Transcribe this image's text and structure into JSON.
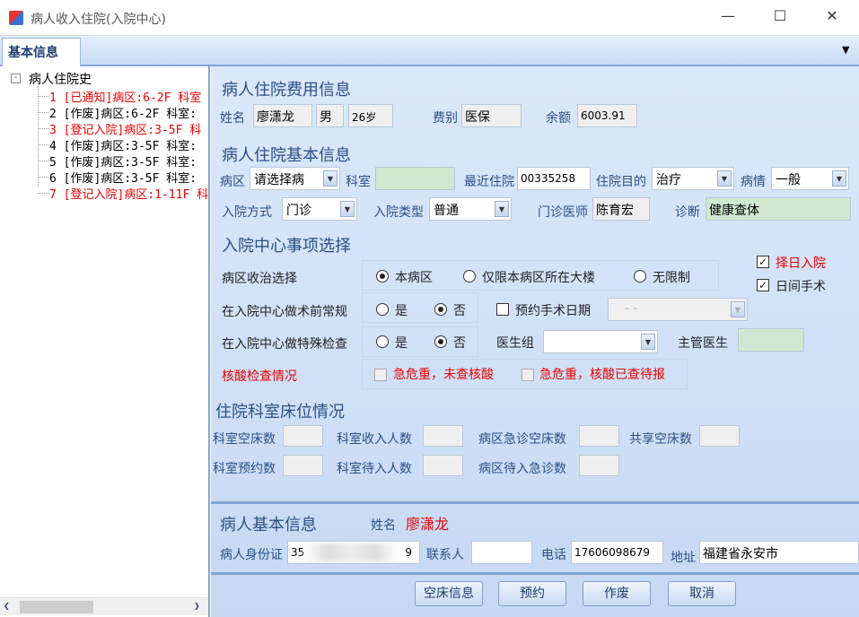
{
  "window": {
    "title": "病人收入住院(入院中心)",
    "min": "—",
    "max": "☐",
    "close": "✕"
  },
  "tab": {
    "label": "基本信息",
    "dropdown": "▼"
  },
  "tree": {
    "root": "病人住院史",
    "items": [
      {
        "text": "1 [已通知]病区:6-2F 科室",
        "color": "red"
      },
      {
        "text": "2 [作废]病区:6-2F 科室:",
        "color": "black"
      },
      {
        "text": "3 [登记入院]病区:3-5F 科",
        "color": "red"
      },
      {
        "text": "4 [作废]病区:3-5F 科室:",
        "color": "black"
      },
      {
        "text": "5 [作废]病区:3-5F 科室:",
        "color": "black"
      },
      {
        "text": "6 [作废]病区:3-5F 科室:",
        "color": "black"
      },
      {
        "text": "7 [登记入院]病区:1-11F 科",
        "color": "red"
      }
    ]
  },
  "fee": {
    "title": "病人住院费用信息",
    "name_label": "姓名",
    "name": "廖潇龙",
    "sex": "男",
    "age": "26岁",
    "type_label": "费别",
    "type": "医保",
    "balance_label": "余额",
    "balance": "6003.91"
  },
  "basic": {
    "title": "病人住院基本信息",
    "ward_label": "病区",
    "ward": "请选择病",
    "dept_label": "科室",
    "dept": "",
    "recent_label": "最近住院",
    "recent": "00335258",
    "purpose_label": "住院目的",
    "purpose": "治疗",
    "condition_label": "病情",
    "condition": "一般",
    "method_label": "入院方式",
    "method": "门诊",
    "admtype_label": "入院类型",
    "admtype": "普通",
    "doctor_label": "门诊医师",
    "doctor": "陈育宏",
    "diag_label": "诊断",
    "diag": "健康查体"
  },
  "center": {
    "title": "入院中心事项选择",
    "ward_choice_label": "病区收治选择",
    "opt_this": "本病区",
    "opt_building": "仅限本病区所在大楼",
    "opt_none": "无限制",
    "pre_op_label": "在入院中心做术前常规",
    "yes": "是",
    "no": "否",
    "book_op_label": "预约手术日期",
    "book_op_value": "-   -",
    "special_label": "在入院中心做特殊检查",
    "doctor_group_label": "医生组",
    "doctor_group": "",
    "attending_label": "主管医生",
    "attending": "",
    "select_day_label": "择日入院",
    "day_surgery_label": "日间手术",
    "nucleic_label": "核酸检查情况",
    "nucleic_opt1": "急危重，未查核酸",
    "nucleic_opt2": "急危重，核酸已查待报"
  },
  "beds": {
    "title": "住院科室床位情况",
    "empty_label": "科室空床数",
    "income_label": "科室收入人数",
    "ward_emergency_empty_label": "病区急诊空床数",
    "shared_empty_label": "共享空床数",
    "booked_label": "科室预约数",
    "pending_label": "科室待入人数",
    "ward_pending_emergency_label": "病区待入急诊数"
  },
  "patient": {
    "title": "病人基本信息",
    "name_label": "姓名",
    "name": "廖潇龙",
    "id_label": "病人身份证",
    "id_prefix": "35",
    "id_suffix": "9",
    "contact_label": "联系人",
    "contact": "",
    "phone_label": "电话",
    "phone": "17606098679",
    "address_label": "地址",
    "address": "福建省永安市"
  },
  "buttons": {
    "empty_bed": "空床信息",
    "book": "预约",
    "void": "作废",
    "cancel": "取消"
  }
}
